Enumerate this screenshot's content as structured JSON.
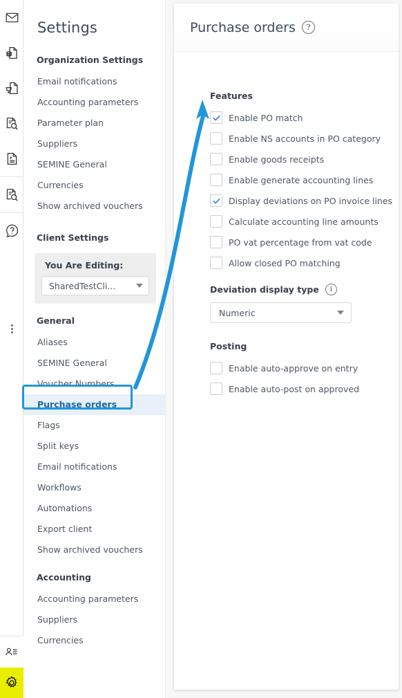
{
  "colors": {
    "accent_blue": "#2196d9",
    "selected_row_bg": "#e8f1f9",
    "selected_row_text": "#1d67a5",
    "gear_highlight_yellow": "#e9ee00",
    "checkbox_check": "#3b7dd8",
    "text_primary": "#38404d",
    "text_secondary": "#4d5664"
  },
  "rail": {
    "icons": [
      {
        "name": "mail-icon",
        "title": "Mail"
      },
      {
        "name": "invoice-document-icon",
        "title": "Invoices"
      },
      {
        "name": "purchase-order-document-icon",
        "title": "Purchase orders"
      },
      {
        "name": "document-search-icon",
        "title": "Search documents"
      },
      {
        "name": "receipt-icon",
        "title": "Receipts"
      },
      {
        "name": "archive-search-icon",
        "title": "Archive search"
      },
      {
        "name": "help-icon",
        "title": "Help"
      }
    ],
    "overflow_name": "more-options-icon",
    "bottom": [
      {
        "name": "user-list-icon",
        "title": "Users"
      },
      {
        "name": "gear-icon",
        "title": "Settings"
      }
    ]
  },
  "sidebar": {
    "title": "Settings",
    "organization": {
      "heading": "Organization Settings",
      "items": [
        "Email notifications",
        "Accounting parameters",
        "Parameter plan",
        "Suppliers",
        "SEMINE General",
        "Currencies",
        "Show archived vouchers"
      ]
    },
    "client": {
      "heading": "Client Settings",
      "editing_label": "You Are Editing:",
      "editing_value": "SharedTestCli...",
      "general_heading": "General",
      "general_items": [
        "Aliases",
        "SEMINE General",
        "Voucher Numbers",
        "Purchase orders",
        "Flags",
        "Split keys",
        "Email notifications",
        "Workflows",
        "Automations",
        "Export client",
        "Show archived vouchers"
      ],
      "selected_item": "Purchase orders",
      "accounting_heading": "Accounting",
      "accounting_items": [
        "Accounting parameters",
        "Suppliers",
        "Currencies"
      ]
    }
  },
  "panel": {
    "title": "Purchase orders",
    "help_glyph": "?",
    "features": {
      "heading": "Features",
      "items": [
        {
          "label": "Enable PO match",
          "checked": true
        },
        {
          "label": "Enable NS accounts in PO category",
          "checked": false
        },
        {
          "label": "Enable goods receipts",
          "checked": false
        },
        {
          "label": "Enable generate accounting lines",
          "checked": false
        },
        {
          "label": "Display deviations on PO invoice lines",
          "checked": true
        },
        {
          "label": "Calculate accounting line amounts",
          "checked": false
        },
        {
          "label": "PO vat percentage from vat code",
          "checked": false
        },
        {
          "label": "Allow closed PO matching",
          "checked": false
        }
      ]
    },
    "deviation": {
      "label": "Deviation display type",
      "info_glyph": "i",
      "value": "Numeric",
      "options": [
        "Numeric"
      ]
    },
    "posting": {
      "heading": "Posting",
      "items": [
        {
          "label": "Enable auto-approve on entry",
          "checked": false
        },
        {
          "label": "Enable auto-post on approved",
          "checked": false
        }
      ]
    }
  },
  "annotation": {
    "type": "arrow",
    "color": "#2196d9",
    "from": "Purchase orders sidebar item",
    "to": "Enable PO match checkbox"
  }
}
